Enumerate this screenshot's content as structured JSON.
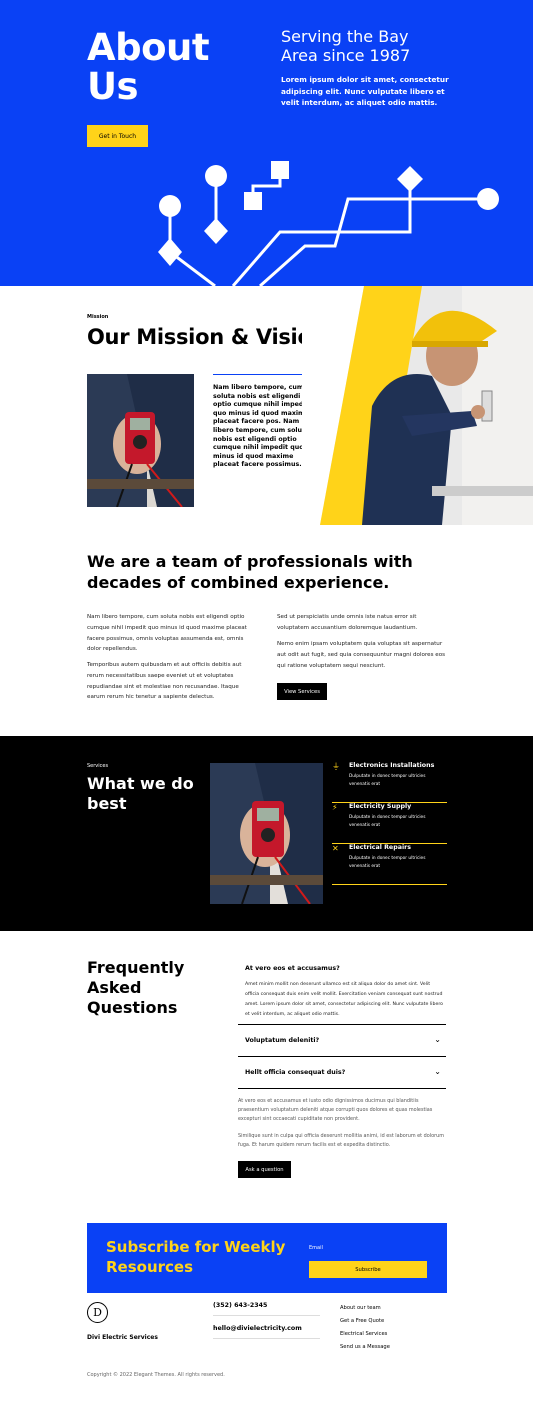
{
  "hero": {
    "title_line1": "About",
    "title_line2": "Us",
    "cta_label": "Get in Touch",
    "subtitle_line1": "Serving the Bay",
    "subtitle_line2": "Area since 1987",
    "body": "Lorem ipsum dolor sit amet, consectetur adipiscing elit. Nunc vulputate libero et velit interdum, ac aliquet odio mattis."
  },
  "mission": {
    "label": "Mission",
    "title": "Our Mission & Vision",
    "text": "Nam libero tempore, cum soluta nobis est eligendi optio cumque nihil impedit quo minus id quod maxime placeat facere pos. Nam libero tempore, cum soluta nobis est eligendi optio cumque nihil impedit quo minus id quod maxime placeat facere possimus."
  },
  "team": {
    "title": "We are a team of professionals with decades of combined experience.",
    "col1_p1": "Nam libero tempore, cum soluta nobis est eligendi optio cumque nihil impedit quo minus id quod maxime placeat facere possimus, omnis voluptas assumenda est, omnis dolor repellendus.",
    "col1_p2": "Temporibus autem quibusdam et aut officiis debitis aut rerum necessitatibus saepe eveniet ut et voluptates repudiandae sint et molestiae non recusandae. Itaque earum rerum hic tenetur a sapiente delectus.",
    "col2_p1": "Sed ut perspiciatis unde omnis iste natus error sit voluptatem accusantium doloremque laudantium.",
    "col2_p2": "Nemo enim ipsam voluptatem quia voluptas sit aspernatur aut odit aut fugit, sed quia consequuntur magni dolores eos qui ratione voluptatem sequi nesciunt.",
    "button_label": "View Services"
  },
  "services": {
    "label": "Services",
    "title_line1": "What we do",
    "title_line2": "best",
    "items": [
      {
        "name": "Electronics Installations",
        "desc": "Dulputate in donec tempor ultricies venenatis erat",
        "icon": "plug-icon"
      },
      {
        "name": "Electricity Supply",
        "desc": "Dulputate in donec tempor ultricies venenatis erat",
        "icon": "bolt-icon"
      },
      {
        "name": "Electrical Repairs",
        "desc": "Dulputate in donec tempor ultricies venenatis erat",
        "icon": "tools-icon"
      }
    ]
  },
  "faq": {
    "title_line1": "Frequently",
    "title_line2": "Asked",
    "title_line3": "Questions",
    "open_question": "At vero eos et accusamus?",
    "open_answer": "Amet minim mollit non deserunt ullamco est sit aliqua dolor do amet sint. Velit officia consequat duis enim velit mollit. Exercitation veniam consequat sunt nostrud amet. Lorem ipsum dolor sit amet, consectetur adipiscing elit. Nunc vulputate libero et velit interdum, ac aliquet odio mattis.",
    "q2": "Voluptatum deleniti?",
    "q3": "Hellt officia consequat duis?",
    "p1": "At vero eos et accusamus et iusto odio dignissimos ducimus qui blanditiis praesentium voluptatum deleniti atque corrupti quos dolores et quas molestias excepturi sint occaecati cupiditate non provident.",
    "p2": "Similique sunt in culpa qui officia deserunt mollitia animi, id est laborum et dolorum fuga. Et harum quidem rerum facilis est et expedita distinctio.",
    "button_label": "Ask a question"
  },
  "subscribe": {
    "title": "Subscribe for Weekly Resources",
    "email_label": "Email",
    "button_label": "Subscribe"
  },
  "footer": {
    "logo_letter": "D",
    "brand": "Divi Electric Services",
    "phone": "(352) 643-2345",
    "email": "hello@divielectricity.com",
    "links": [
      "About our team",
      "Get a Free Quote",
      "Electrical Services",
      "Send us a Message"
    ],
    "copyright": "Copyright © 2022 Elegant Themes. All rights reserved."
  },
  "colors": {
    "brand_blue": "#0a41f5",
    "accent_yellow": "#ffd319"
  }
}
